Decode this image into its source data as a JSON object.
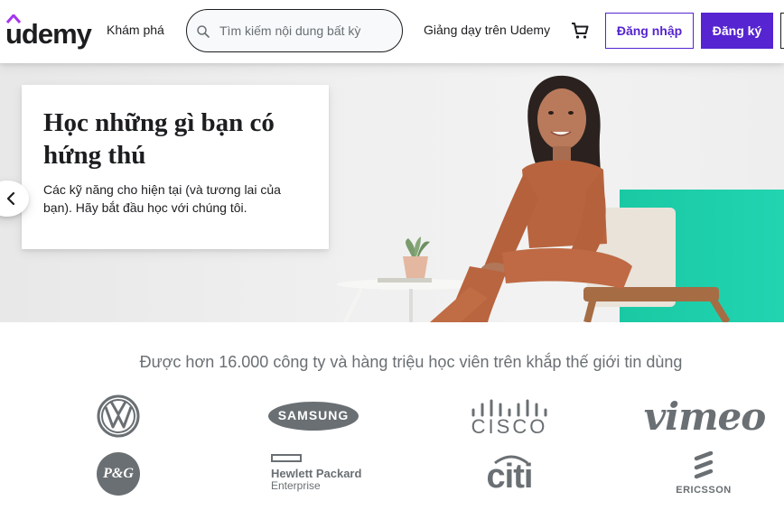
{
  "header": {
    "logo_text": "udemy",
    "explore_label": "Khám phá",
    "search_placeholder": "Tìm kiếm nội dung bất kỳ",
    "teach_label": "Giảng dạy trên Udemy",
    "login_label": "Đăng nhập",
    "signup_label": "Đăng ký"
  },
  "hero": {
    "title": "Học những gì bạn có hứng thú",
    "subtitle": "Các kỹ năng cho hiện tại (và tương lai của bạn). Hãy bắt đầu học với chúng tôi."
  },
  "trust": {
    "title": "Được hơn 16.000 công ty và hàng triệu học viên trên khắp thế giới tin dùng",
    "logos": [
      "Volkswagen",
      "Samsung",
      "Cisco",
      "Vimeo",
      "P&G",
      "Hewlett Packard Enterprise",
      "Citi",
      "Ericsson"
    ],
    "samsung_text": "SAMSUNG",
    "cisco_text": "CISCO",
    "vimeo_text": "vimeo",
    "pg_text": "P&G",
    "hpe_line1": "Hewlett Packard",
    "hpe_line2": "Enterprise",
    "citi_text": "citi",
    "ericsson_text": "ERICSSON"
  },
  "colors": {
    "brand_purple": "#5624d0",
    "text_dark": "#1c1d1f",
    "text_muted": "#6a6f73",
    "teal": "#1ec7a4"
  }
}
